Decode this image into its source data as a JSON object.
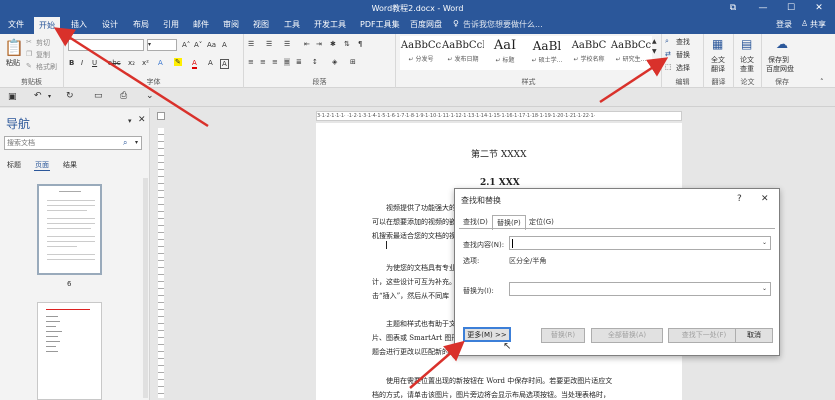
{
  "titlebar": {
    "title": "Word教程2.docx - Word",
    "min": "—",
    "max": "☐",
    "close": "✕",
    "restore": "⧉"
  },
  "tabs": {
    "file": "文件",
    "home": "开始",
    "insert": "插入",
    "design": "设计",
    "layout": "布局",
    "references": "引用",
    "mailings": "邮件",
    "review": "审阅",
    "view": "视图",
    "tools": "工具",
    "developer": "开发工具",
    "pdf": "PDF工具集",
    "baidu": "百度网盘",
    "tell": "告诉我您想要做什么...",
    "login": "登录",
    "share": "共享"
  },
  "ribbon": {
    "clipboard": {
      "paste": "粘贴",
      "cut": "剪切",
      "copy": "复制",
      "painter": "格式刷",
      "label": "剪贴板"
    },
    "font": {
      "label": "字体",
      "grow": "A˄",
      "shrink": "A˅",
      "case": "Aa",
      "clear": "A"
    },
    "paragraph": {
      "label": "段落"
    },
    "styles": {
      "label": "样式",
      "items": [
        {
          "sample": "AaBbCc",
          "name": "↵ 分发号"
        },
        {
          "sample": "AaBbCcD",
          "name": "↵ 发布日期"
        },
        {
          "sample": "AaI",
          "name": "↵ 标题"
        },
        {
          "sample": "AaBl",
          "name": "↵ 硕士学..."
        },
        {
          "sample": "AaBbC",
          "name": "↵ 学校名称"
        },
        {
          "sample": "AaBbCc",
          "name": "↵ 研究生..."
        }
      ]
    },
    "editing": {
      "find": "查找",
      "replace": "替换",
      "select": "选择",
      "label": "编辑"
    },
    "fulltext": {
      "label1": "全文",
      "label2": "翻译",
      "group": "翻译"
    },
    "paper": {
      "label1": "论文",
      "label2": "查重",
      "group": "论文"
    },
    "save": {
      "label1": "保存到",
      "label2": "百度网盘",
      "group": "保存"
    }
  },
  "nav": {
    "title": "导航",
    "search_placeholder": "搜索文档",
    "tab_headings": "标题",
    "tab_pages": "页面",
    "tab_results": "结果",
    "page6": "6"
  },
  "ruler": {
    "text": "3·1·2·1·1·1·  ·1·2·1·3·1·4·1·5·1·6·1·7·1·8·1·9·1·10·1·11·1·12·1·13·1·14·1·15·1·16·1·17·1·18·1·19·1·20·1·21·1·22·1·"
  },
  "doc": {
    "heading": "第二节  XXXX",
    "subheading": "2.1 XXX",
    "p1a": "视频提供了功能强大的",
    "p1b": "可以在想要添加的视频的嵌",
    "p1c": "机搜索最适合您的文档的视",
    "p2a": "为使您的文档具有专业",
    "p2b": "计，这些设计可互为补充。",
    "p2c": "击“插入”，然后从不同库",
    "p3a": "主题和样式也有助于文",
    "p3b": "片、图表或 SmartArt 图形",
    "p3c": "题会进行更改以匹配新的主",
    "p4a": "使用在需要位置出现的新按钮在 Word 中保存时间。若要更改图片适应文",
    "p4b": "档的方式，请单击该图片，图片旁边将会显示布局选项按钮。当处理表格时，"
  },
  "dialog": {
    "title": "查找和替换",
    "help": "?",
    "close": "✕",
    "tab_find": "查找(D)",
    "tab_replace": "替换(P)",
    "tab_goto": "定位(G)",
    "find_label": "查找内容(N):",
    "find_value": "",
    "options_label": "选项:",
    "options_value": "区分全/半角",
    "replace_label": "替换为(I):",
    "replace_value": "",
    "more": "更多(M) >>",
    "replace_btn": "替换(R)",
    "replace_all": "全部替换(A)",
    "find_next": "查找下一处(F)",
    "cancel": "取消"
  },
  "colors": {
    "accent": "#2b579a",
    "arrow": "#d9312b"
  }
}
